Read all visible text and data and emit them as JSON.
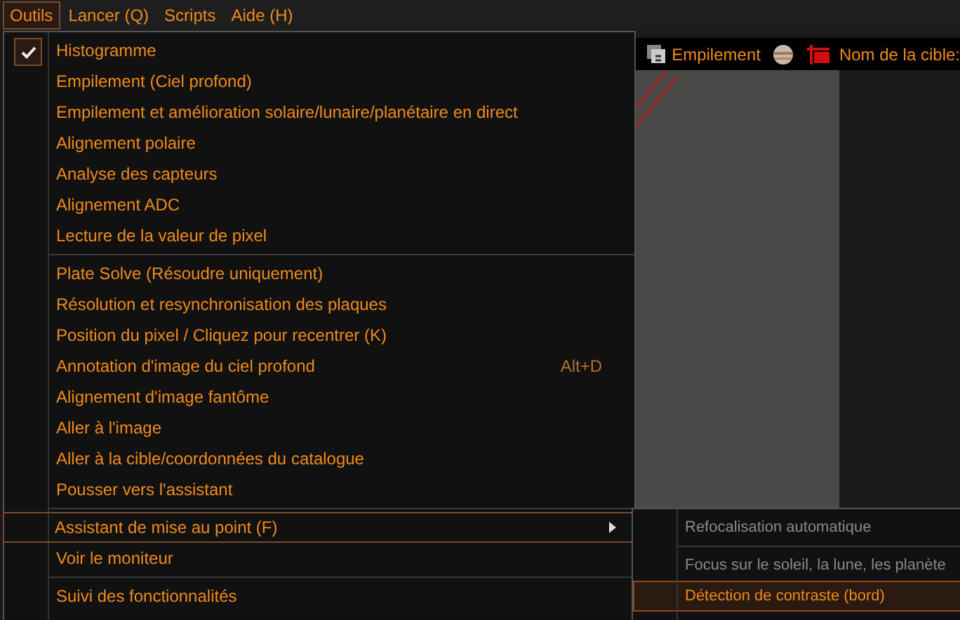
{
  "menubar": [
    {
      "label": "Outils",
      "selected": true
    },
    {
      "label": "Lancer (Q)",
      "selected": false
    },
    {
      "label": "Scripts",
      "selected": false
    },
    {
      "label": "Aide (H)",
      "selected": false
    }
  ],
  "toolbar": {
    "stack_label": "Empilement",
    "target_label": "Nom de la cible:"
  },
  "menu": {
    "items": [
      {
        "kind": "item",
        "label": "Histogramme",
        "checked": true,
        "selected": false
      },
      {
        "kind": "item",
        "label": "Empilement (Ciel profond)",
        "checked": false,
        "selected": false
      },
      {
        "kind": "item",
        "label": "Empilement et amélioration solaire/lunaire/planétaire en direct",
        "checked": false,
        "selected": false
      },
      {
        "kind": "item",
        "label": "Alignement polaire",
        "checked": false,
        "selected": false
      },
      {
        "kind": "item",
        "label": "Analyse des capteurs",
        "checked": false,
        "selected": false
      },
      {
        "kind": "item",
        "label": "Alignement ADC",
        "checked": false,
        "selected": false
      },
      {
        "kind": "item",
        "label": "Lecture de la valeur de pixel",
        "checked": false,
        "selected": false
      },
      {
        "kind": "separator"
      },
      {
        "kind": "item",
        "label": "Plate Solve (Résoudre uniquement)",
        "checked": false,
        "selected": false
      },
      {
        "kind": "item",
        "label": "Résolution et resynchronisation des plaques",
        "checked": false,
        "selected": false
      },
      {
        "kind": "item",
        "label": "Position du pixel / Cliquez pour recentrer (K)",
        "checked": false,
        "selected": false
      },
      {
        "kind": "item",
        "label": "Annotation d'image du ciel profond",
        "shortcut": "Alt+D",
        "checked": false,
        "selected": false
      },
      {
        "kind": "item",
        "label": "Alignement d'image fantôme",
        "checked": false,
        "selected": false
      },
      {
        "kind": "item",
        "label": "Aller à l'image",
        "checked": false,
        "selected": false
      },
      {
        "kind": "item",
        "label": "Aller à la cible/coordonnées du catalogue",
        "checked": false,
        "selected": false
      },
      {
        "kind": "item",
        "label": "Pousser vers l'assistant",
        "checked": false,
        "selected": false
      },
      {
        "kind": "separator"
      },
      {
        "kind": "item",
        "label": "Assistant de mise au point (F)",
        "submenu": true,
        "checked": false,
        "selected": true
      },
      {
        "kind": "item",
        "label": "Voir le moniteur",
        "checked": false,
        "selected": false
      },
      {
        "kind": "separator"
      },
      {
        "kind": "item",
        "label": "Suivi des fonctionnalités",
        "checked": false,
        "selected": false
      }
    ]
  },
  "submenu": {
    "items": [
      {
        "kind": "item",
        "label": "Refocalisation automatique",
        "disabled": true,
        "selected": false
      },
      {
        "kind": "separator"
      },
      {
        "kind": "item",
        "label": "Focus sur le soleil, la lune, les planète",
        "disabled": true,
        "selected": false
      },
      {
        "kind": "item",
        "label": "Détection de contraste (bord)",
        "disabled": false,
        "selected": true
      }
    ]
  }
}
